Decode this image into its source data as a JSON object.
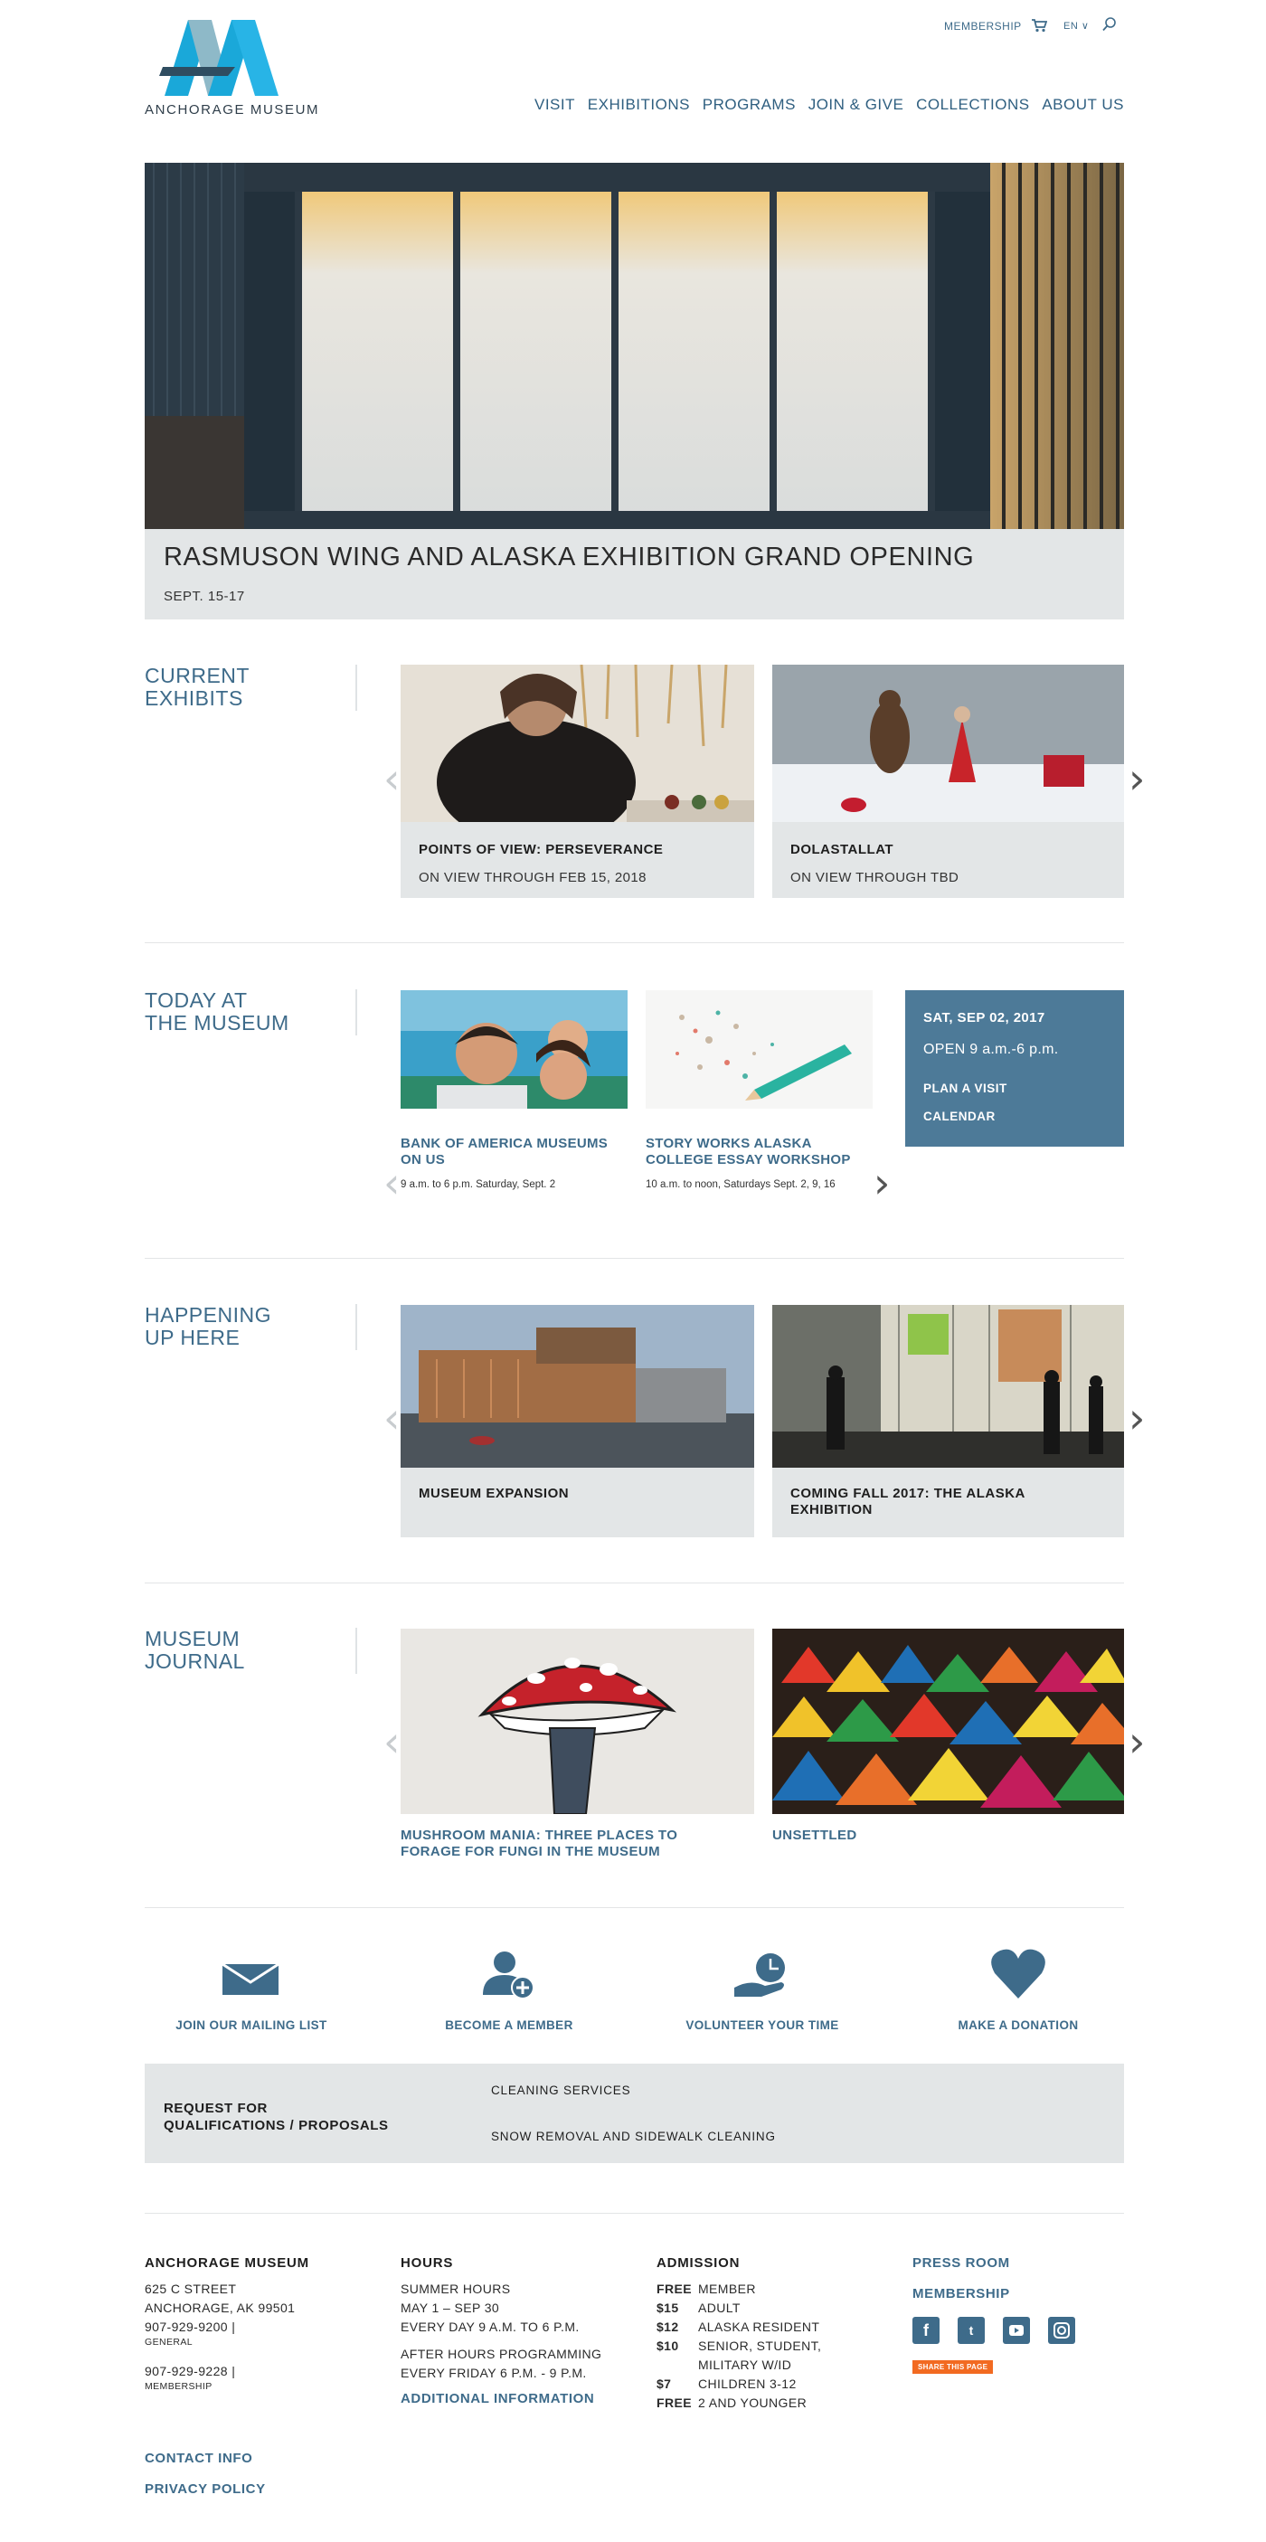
{
  "header": {
    "logo_text": "ANCHORAGE MUSEUM",
    "membership": "MEMBERSHIP",
    "lang": "EN ∨",
    "nav": [
      "VISIT",
      "EXHIBITIONS",
      "PROGRAMS",
      "JOIN & GIVE",
      "COLLECTIONS",
      "ABOUT US"
    ]
  },
  "hero": {
    "title": "RASMUSON WING AND ALASKA EXHIBITION GRAND OPENING",
    "date": "SEPT. 15-17"
  },
  "current": {
    "title_lines": [
      "CURRENT",
      "EXHIBITS"
    ],
    "cards": [
      {
        "title": "POINTS OF VIEW: PERSEVERANCE",
        "sub": "ON VIEW THROUGH FEB 15, 2018"
      },
      {
        "title": "DOLASTALLAT",
        "sub": "ON VIEW THROUGH TBD"
      }
    ]
  },
  "today": {
    "title_lines": [
      "TODAY AT",
      "THE MUSEUM"
    ],
    "events": [
      {
        "title_lines": [
          "BANK OF AMERICA MUSEUMS",
          "ON US"
        ],
        "sub": "9 a.m. to 6 p.m. Saturday, Sept. 2"
      },
      {
        "title_lines": [
          "STORY WORKS ALASKA",
          "COLLEGE ESSAY WORKSHOP"
        ],
        "sub": "10 a.m. to noon, Saturdays Sept. 2, 9, 16"
      }
    ],
    "calendar": {
      "date": "SAT, SEP 02, 2017",
      "open": "OPEN 9 a.m.-6 p.m.",
      "plan": "PLAN A VISIT",
      "calendar": "CALENDAR"
    }
  },
  "happening": {
    "title_lines": [
      "HAPPENING",
      "UP HERE"
    ],
    "cards": [
      {
        "title_lines": [
          "MUSEUM EXPANSION"
        ]
      },
      {
        "title_lines": [
          "COMING FALL 2017: THE ALASKA",
          "EXHIBITION"
        ]
      }
    ]
  },
  "journal": {
    "title_lines": [
      "MUSEUM",
      "JOURNAL"
    ],
    "cards": [
      {
        "title_lines": [
          "MUSHROOM MANIA: THREE PLACES TO",
          "FORAGE FOR FUNGI IN THE MUSEUM"
        ]
      },
      {
        "title_lines": [
          "UNSETTLED"
        ]
      }
    ]
  },
  "ctas": [
    "JOIN OUR MAILING LIST",
    "BECOME A MEMBER",
    "VOLUNTEER YOUR TIME",
    "MAKE A DONATION"
  ],
  "rfq": {
    "title_lines": [
      "REQUEST FOR",
      "QUALIFICATIONS / PROPOSALS"
    ],
    "items": [
      "CLEANING SERVICES",
      "SNOW REMOVAL AND SIDEWALK CLEANING"
    ]
  },
  "footer": {
    "museum": {
      "heading": "ANCHORAGE MUSEUM",
      "street": "625 C STREET",
      "city": "ANCHORAGE, AK 99501",
      "phone1": "907-929-9200 |",
      "phone1_label": "GENERAL",
      "phone2": "907-929-9228 |",
      "phone2_label": "MEMBERSHIP"
    },
    "hours": {
      "heading": "HOURS",
      "lines": [
        "SUMMER HOURS",
        "MAY 1 – SEP 30",
        "EVERY DAY 9 A.M. TO 6 P.M."
      ],
      "after_lines": [
        "AFTER HOURS PROGRAMMING",
        "EVERY FRIDAY 6 P.M. - 9 P.M."
      ],
      "link": "ADDITIONAL INFORMATION"
    },
    "admission": {
      "heading": "ADMISSION",
      "rows": [
        {
          "price": "FREE",
          "label": "MEMBER"
        },
        {
          "price": "$15",
          "label": "ADULT"
        },
        {
          "price": "$12",
          "label": "ALASKA RESIDENT"
        },
        {
          "price": "$10",
          "label": "SENIOR, STUDENT,"
        },
        {
          "price": "",
          "label": "MILITARY W/ID"
        },
        {
          "price": "$7",
          "label": "CHILDREN 3-12"
        },
        {
          "price": "FREE",
          "label": "2 AND YOUNGER"
        }
      ]
    },
    "links": {
      "press": "PRESS ROOM",
      "membership": "MEMBERSHIP",
      "share": "SHARE THIS PAGE"
    },
    "bottom": {
      "contact": "CONTACT INFO",
      "privacy": "PRIVACY POLICY"
    }
  },
  "colors": {
    "accent": "#3e6b8a",
    "calendar_bg": "#4d7a98",
    "card_bg": "#e3e6e7",
    "share": "#f26a21"
  }
}
